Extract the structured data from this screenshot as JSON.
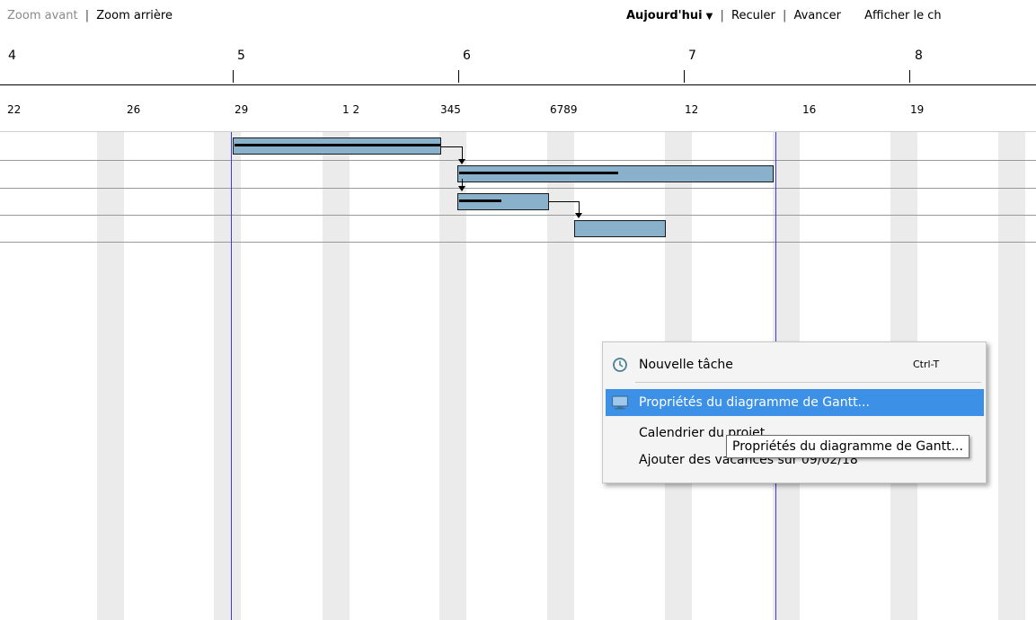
{
  "toolbar": {
    "zoom_in": "Zoom avant",
    "separator": "|",
    "zoom_out": "Zoom arrière",
    "today": "Aujourd'hui",
    "back": "Reculer",
    "forward": "Avancer",
    "show_critical": "Afficher le ch"
  },
  "timeline": {
    "weeks": [
      "4",
      "5",
      "6",
      "7",
      "8"
    ],
    "days": [
      "22",
      "26",
      "29",
      "1 2",
      "345",
      "6789",
      "12",
      "16",
      "19"
    ]
  },
  "context_menu": {
    "items": [
      {
        "label": "Nouvelle tâche",
        "shortcut": "Ctrl-T",
        "icon": "clock-icon"
      },
      {
        "label": "Propriétés du diagramme de Gantt...",
        "icon": "monitor-icon",
        "selected": true
      },
      {
        "label": "Calendrier du projet"
      },
      {
        "label": "Ajouter des vacances sur 09/02/18"
      }
    ]
  },
  "tooltip": {
    "text": "Propriétés du diagramme de Gantt..."
  },
  "colors": {
    "bar_fill": "#8ab1cc",
    "today_line": "#3a3ae8",
    "weekend": "#ebebeb",
    "menu_highlight": "#3c91e6"
  }
}
